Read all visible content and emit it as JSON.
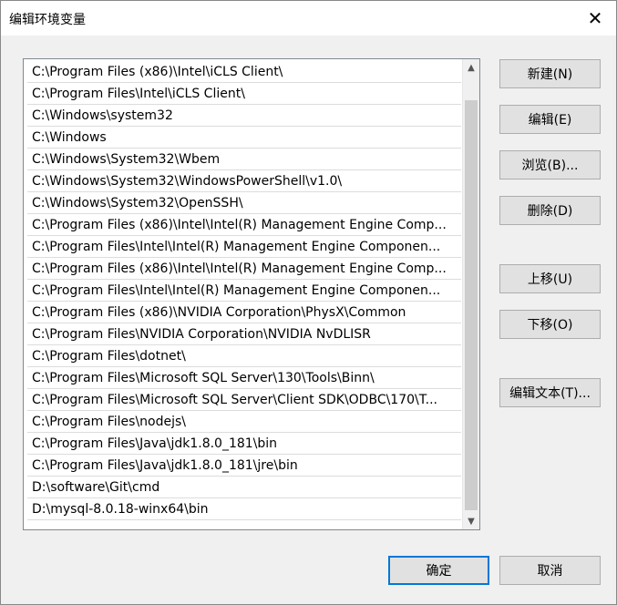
{
  "window": {
    "title": "编辑环境变量",
    "close_icon": "close-icon"
  },
  "paths": [
    "C:\\Program Files (x86)\\Intel\\iCLS Client\\",
    "C:\\Program Files\\Intel\\iCLS Client\\",
    "C:\\Windows\\system32",
    "C:\\Windows",
    "C:\\Windows\\System32\\Wbem",
    "C:\\Windows\\System32\\WindowsPowerShell\\v1.0\\",
    "C:\\Windows\\System32\\OpenSSH\\",
    "C:\\Program Files (x86)\\Intel\\Intel(R) Management Engine Comp...",
    "C:\\Program Files\\Intel\\Intel(R) Management Engine Componen...",
    "C:\\Program Files (x86)\\Intel\\Intel(R) Management Engine Comp...",
    "C:\\Program Files\\Intel\\Intel(R) Management Engine Componen...",
    "C:\\Program Files (x86)\\NVIDIA Corporation\\PhysX\\Common",
    "C:\\Program Files\\NVIDIA Corporation\\NVIDIA NvDLISR",
    "C:\\Program Files\\dotnet\\",
    "C:\\Program Files\\Microsoft SQL Server\\130\\Tools\\Binn\\",
    "C:\\Program Files\\Microsoft SQL Server\\Client SDK\\ODBC\\170\\T...",
    "C:\\Program Files\\nodejs\\",
    "C:\\Program Files\\Java\\jdk1.8.0_181\\bin",
    "C:\\Program Files\\Java\\jdk1.8.0_181\\jre\\bin",
    "D:\\software\\Git\\cmd",
    "D:\\mysql-8.0.18-winx64\\bin"
  ],
  "buttons": {
    "new": "新建(N)",
    "edit": "编辑(E)",
    "browse": "浏览(B)...",
    "delete": "删除(D)",
    "move_up": "上移(U)",
    "move_down": "下移(O)",
    "edit_text": "编辑文本(T)...",
    "ok": "确定",
    "cancel": "取消"
  },
  "scrollbar": {
    "up_icon": "chevron-up-icon",
    "down_icon": "chevron-down-icon"
  },
  "colors": {
    "primary_border": "#0078d7"
  }
}
